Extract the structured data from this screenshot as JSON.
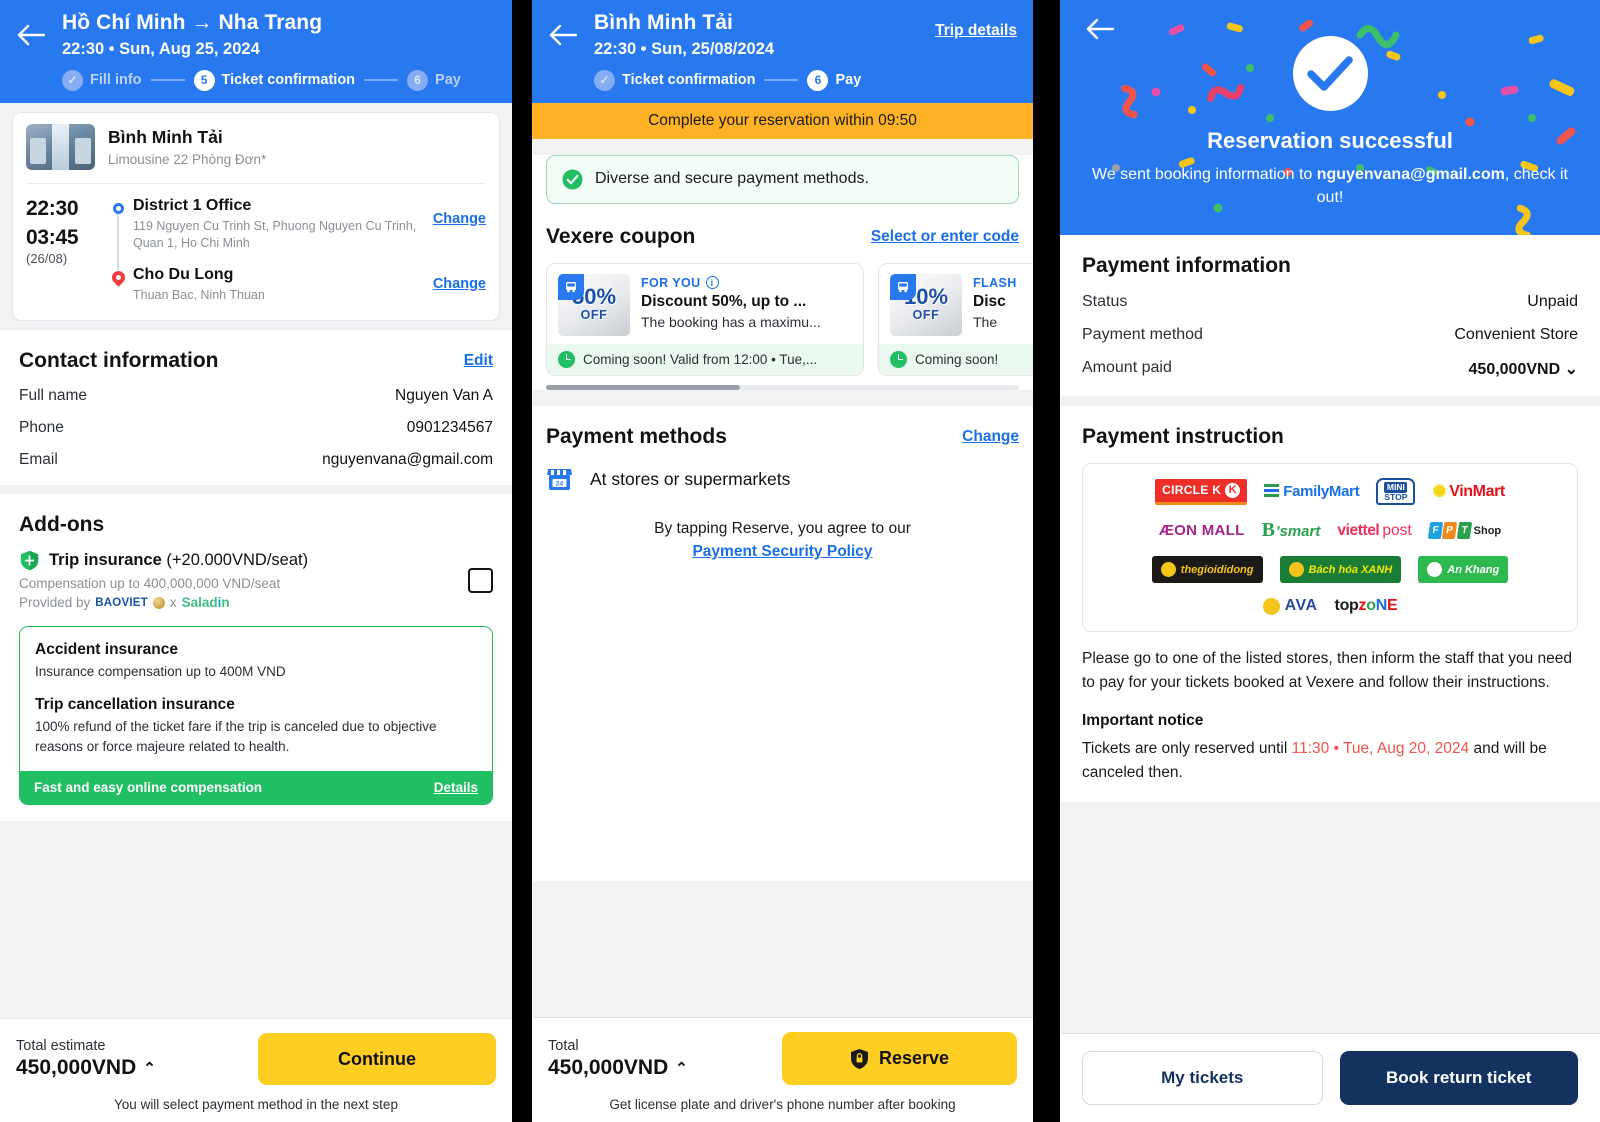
{
  "panel1": {
    "header": {
      "title": "Hồ Chí Minh → Nha Trang",
      "subtitle": "22:30 • Sun, Aug 25, 2024",
      "steps": [
        {
          "label": "Fill info",
          "num": "✓",
          "state": "done"
        },
        {
          "label": "Ticket confirmation",
          "num": "5",
          "state": "current"
        },
        {
          "label": "Pay",
          "num": "6",
          "state": "next"
        }
      ]
    },
    "operator": {
      "name": "Bình Minh Tải",
      "type": "Limousine 22 Phòng Đơn*"
    },
    "route": {
      "pickup": {
        "time": "22:30",
        "name": "District 1 Office",
        "address": "119 Nguyen Cu Trinh St, Phuong Nguyen Cu Trinh, Quan 1, Ho Chi Minh",
        "change_label": "Change"
      },
      "dropoff": {
        "time": "03:45",
        "date": "(26/08)",
        "name": "Cho Du Long",
        "address": "Thuan Bac, Ninh Thuan",
        "change_label": "Change"
      }
    },
    "contact": {
      "title": "Contact information",
      "edit_label": "Edit",
      "rows": [
        {
          "key": "Full name",
          "value": "Nguyen Van A"
        },
        {
          "key": "Phone",
          "value": "0901234567"
        },
        {
          "key": "Email",
          "value": "nguyenvana@gmail.com"
        }
      ]
    },
    "addons": {
      "title": "Add-ons",
      "insurance_name": "Trip insurance",
      "insurance_price": "(+20.000VND/seat)",
      "compensation": "Compensation up to 400,000,000 VND/seat",
      "provided_by": "Provided by",
      "provider_1": "BAOVIET",
      "provider_sep": "x",
      "provider_2a": "Salad",
      "provider_2b": "i",
      "provider_2c": "n",
      "checked": false,
      "detail_box": {
        "item1_title": "Accident insurance",
        "item1_desc": "Insurance compensation up to 400M VND",
        "item2_title": "Trip cancellation insurance",
        "item2_desc": "100% refund of the ticket fare if the trip is canceled due to objective reasons or force majeure related to health.",
        "footer_text": "Fast and easy online compensation",
        "footer_link": "Details"
      }
    },
    "bottom": {
      "total_label": "Total estimate",
      "total_value": "450,000VND",
      "caret": "⌃",
      "button_label": "Continue",
      "note": "You will select payment method in the next step"
    }
  },
  "panel2": {
    "header": {
      "title": "Bình Minh Tải",
      "subtitle": "22:30 • Sun, 25/08/2024",
      "trip_details": "Trip details",
      "steps": [
        {
          "label": "Ticket confirmation",
          "num": "✓",
          "state": "done"
        },
        {
          "label": "Pay",
          "num": "6",
          "state": "current"
        }
      ]
    },
    "timer": "Complete your reservation within 09:50",
    "notice": "Diverse and secure payment methods.",
    "coupon": {
      "title": "Vexere coupon",
      "select_link": "Select or enter code",
      "items": [
        {
          "percent": "50%",
          "off": "OFF",
          "tag": "FOR YOU",
          "name": "Discount 50%, up to ...",
          "desc": "The booking has a maximu...",
          "footer": "Coming soon! Valid from 12:00 • Tue,..."
        },
        {
          "percent": "10%",
          "off": "OFF",
          "tag": "FLASH",
          "name": "Disc",
          "desc": "The",
          "footer": "Coming soon!"
        }
      ]
    },
    "payment_methods": {
      "title": "Payment methods",
      "change_label": "Change",
      "selected": "At stores or supermarkets"
    },
    "agreement": {
      "text": "By tapping Reserve, you agree to our",
      "link": "Payment Security Policy"
    },
    "bottom": {
      "total_label": "Total",
      "total_value": "450,000VND",
      "caret": "⌃",
      "button_label": "Reserve",
      "note": "Get license plate and driver's phone number after booking"
    }
  },
  "panel3": {
    "success": {
      "title": "Reservation successful",
      "message_pre": "We sent booking information to ",
      "email": "nguyenvana@gmail.com",
      "message_post": ", check it out!"
    },
    "payment_information": {
      "title": "Payment information",
      "rows": [
        {
          "key": "Status",
          "value": "Unpaid",
          "style": "red"
        },
        {
          "key": "Payment method",
          "value": "Convenient Store",
          "style": "normal"
        },
        {
          "key": "Amount paid",
          "value": "450,000VND",
          "style": "bold",
          "caret": "⌄"
        }
      ]
    },
    "payment_instruction": {
      "title": "Payment instruction",
      "store_rows": [
        [
          "CIRCLE K",
          "FamilyMart",
          "MINI STOP",
          "VinMart"
        ],
        [
          "ÆON MALL",
          "B's mart",
          "viettel post",
          "FPT Shop"
        ],
        [
          "thegioididong",
          "Bách hóa XANH",
          "An Khang"
        ],
        [
          "AVA",
          "topzone"
        ]
      ],
      "instruction": "Please go to one of the listed stores, then inform the staff that you need to pay for your tickets booked at Vexere and follow their instructions.",
      "important_title": "Important notice",
      "important_pre": "Tickets are only reserved until ",
      "important_time": "11:30 • Tue, Aug 20, 2024",
      "important_post": " and will be canceled then."
    },
    "bottom": {
      "my_tickets": "My tickets",
      "book_return": "Book return ticket"
    }
  },
  "colors": {
    "brand_blue": "#2878F0",
    "yellow": "#FFCE22",
    "green": "#21BF63",
    "red": "#F0544A",
    "navy": "#14325F",
    "amber": "#FFB224"
  }
}
